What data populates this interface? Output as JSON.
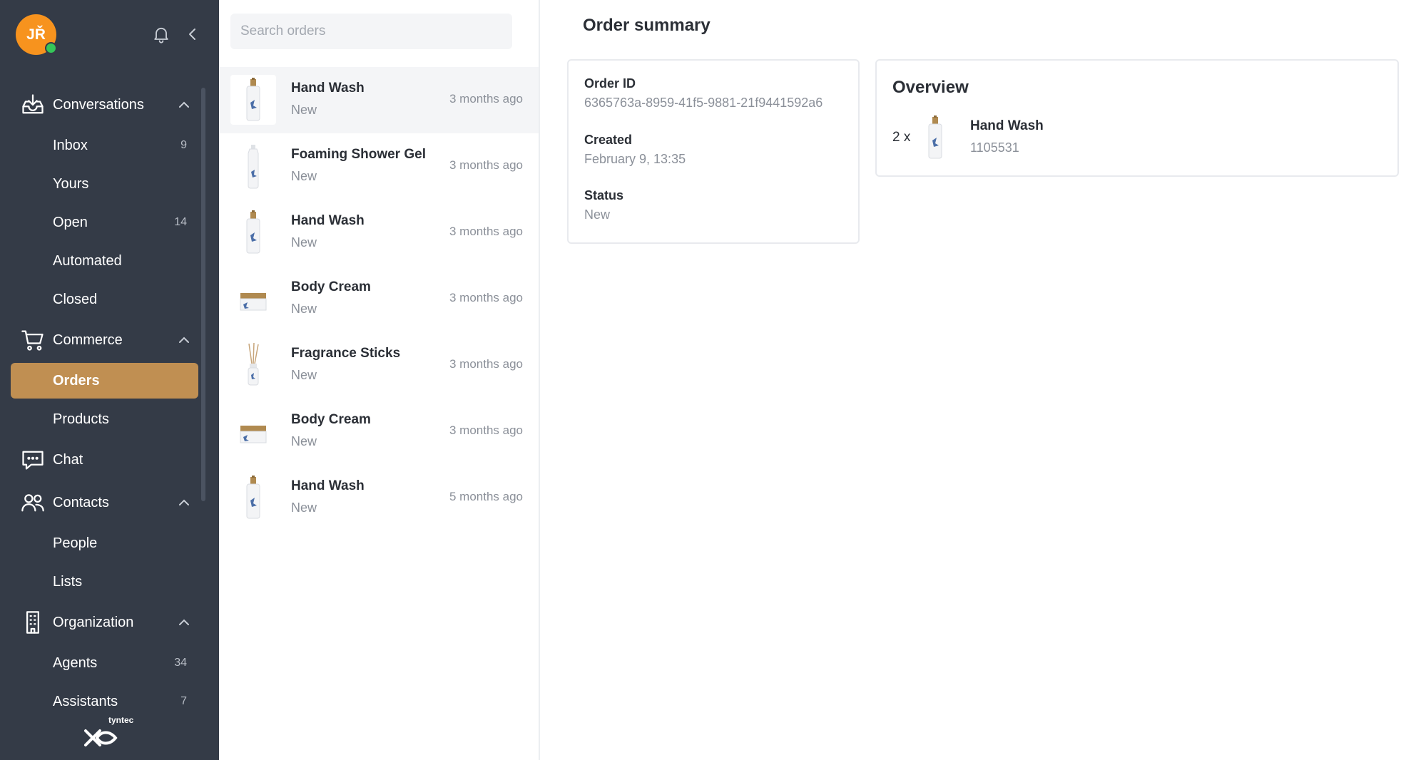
{
  "user": {
    "initials": "JŘ"
  },
  "sidebar": {
    "sections": [
      {
        "label": "Conversations",
        "icon": "inbox-tray-icon",
        "items": [
          {
            "label": "Inbox",
            "count": "9"
          },
          {
            "label": "Yours",
            "count": ""
          },
          {
            "label": "Open",
            "count": "14"
          },
          {
            "label": "Automated",
            "count": ""
          },
          {
            "label": "Closed",
            "count": ""
          }
        ]
      },
      {
        "label": "Commerce",
        "icon": "shopping-cart-icon",
        "items": [
          {
            "label": "Orders",
            "count": ""
          },
          {
            "label": "Products",
            "count": ""
          }
        ]
      },
      {
        "label": "Chat",
        "icon": "chat-bubble-icon",
        "items": []
      },
      {
        "label": "Contacts",
        "icon": "people-icon",
        "items": [
          {
            "label": "People",
            "count": ""
          },
          {
            "label": "Lists",
            "count": ""
          }
        ]
      },
      {
        "label": "Organization",
        "icon": "building-icon",
        "items": [
          {
            "label": "Agents",
            "count": "34"
          },
          {
            "label": "Assistants",
            "count": "7"
          }
        ]
      }
    ],
    "brand": "tyntec"
  },
  "search": {
    "placeholder": "Search orders"
  },
  "orders": [
    {
      "name": "Hand Wash",
      "status": "New",
      "time": "3 months ago",
      "product": "hand-wash"
    },
    {
      "name": "Foaming Shower Gel",
      "status": "New",
      "time": "3 months ago",
      "product": "shower-gel"
    },
    {
      "name": "Hand Wash",
      "status": "New",
      "time": "3 months ago",
      "product": "hand-wash"
    },
    {
      "name": "Body Cream",
      "status": "New",
      "time": "3 months ago",
      "product": "body-cream"
    },
    {
      "name": "Fragrance Sticks",
      "status": "New",
      "time": "3 months ago",
      "product": "fragrance-sticks"
    },
    {
      "name": "Body Cream",
      "status": "New",
      "time": "3 months ago",
      "product": "body-cream"
    },
    {
      "name": "Hand Wash",
      "status": "New",
      "time": "5 months ago",
      "product": "hand-wash"
    }
  ],
  "detail": {
    "title": "Order summary",
    "summary": {
      "order_id_label": "Order ID",
      "order_id": "6365763a-8959-41f5-9881-21f9441592a6",
      "created_label": "Created",
      "created": "February 9, 13:35",
      "status_label": "Status",
      "status": "New"
    },
    "overview": {
      "title": "Overview",
      "quantity": "2 x",
      "product_name": "Hand Wash",
      "sku": "1105531"
    }
  },
  "colors": {
    "sidebar_bg": "#343b47",
    "accent": "#c08f52",
    "avatar": "#f7931e",
    "presence": "#35c659"
  }
}
